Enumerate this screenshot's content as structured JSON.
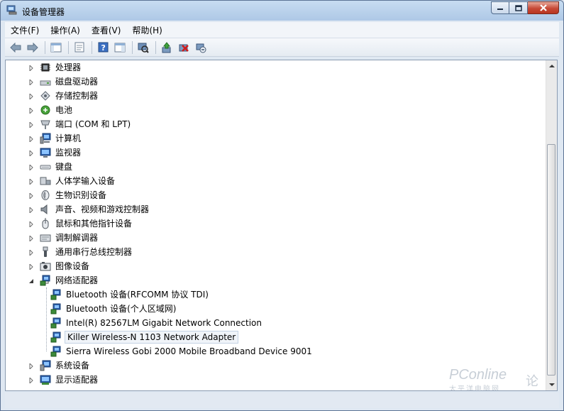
{
  "window": {
    "title": "设备管理器"
  },
  "menu": [
    "文件(F)",
    "操作(A)",
    "查看(V)",
    "帮助(H)"
  ],
  "toolbar": [
    "back-icon",
    "forward-icon",
    "console-tree-icon",
    "properties-icon",
    "help-icon",
    "view-icon",
    "scan-hardware-icon",
    "update-driver-icon",
    "uninstall-icon",
    "disable-icon"
  ],
  "tree": {
    "categories": [
      {
        "label": "处理器",
        "icon": "processor-icon",
        "expanded": false
      },
      {
        "label": "磁盘驱动器",
        "icon": "disk-drive-icon",
        "expanded": false
      },
      {
        "label": "存储控制器",
        "icon": "storage-controller-icon",
        "expanded": false
      },
      {
        "label": "电池",
        "icon": "battery-icon",
        "expanded": false
      },
      {
        "label": "端口 (COM 和 LPT)",
        "icon": "port-icon",
        "expanded": false
      },
      {
        "label": "计算机",
        "icon": "computer-icon",
        "expanded": false
      },
      {
        "label": "监视器",
        "icon": "monitor-icon",
        "expanded": false
      },
      {
        "label": "键盘",
        "icon": "keyboard-icon",
        "expanded": false
      },
      {
        "label": "人体学输入设备",
        "icon": "hid-icon",
        "expanded": false
      },
      {
        "label": "生物识别设备",
        "icon": "biometric-icon",
        "expanded": false
      },
      {
        "label": "声音、视频和游戏控制器",
        "icon": "sound-icon",
        "expanded": false
      },
      {
        "label": "鼠标和其他指针设备",
        "icon": "mouse-icon",
        "expanded": false
      },
      {
        "label": "调制解调器",
        "icon": "modem-icon",
        "expanded": false
      },
      {
        "label": "通用串行总线控制器",
        "icon": "usb-icon",
        "expanded": false
      },
      {
        "label": "图像设备",
        "icon": "imaging-icon",
        "expanded": false
      },
      {
        "label": "网络适配器",
        "icon": "network-adapter-icon",
        "expanded": true,
        "children": [
          {
            "label": "Bluetooth 设备(RFCOMM 协议 TDI)",
            "selected": false
          },
          {
            "label": "Bluetooth 设备(个人区域网)",
            "selected": false
          },
          {
            "label": "Intel(R) 82567LM Gigabit Network Connection",
            "selected": false
          },
          {
            "label": "Killer Wireless-N 1103 Network Adapter",
            "selected": true
          },
          {
            "label": "Sierra Wireless Gobi 2000 Mobile Broadband Device 9001",
            "selected": false
          }
        ]
      },
      {
        "label": "系统设备",
        "icon": "system-devices-icon",
        "expanded": false
      },
      {
        "label": "显示适配器",
        "icon": "display-adapter-icon",
        "expanded": false
      }
    ]
  },
  "watermark": {
    "brand": "PConline",
    "sub": "太平洋电脑网",
    "tag": "论坛"
  },
  "colors": {
    "accent": "#3a6ea5",
    "selection_bg": "#f0f4f9",
    "close_button": "#c74a37"
  }
}
